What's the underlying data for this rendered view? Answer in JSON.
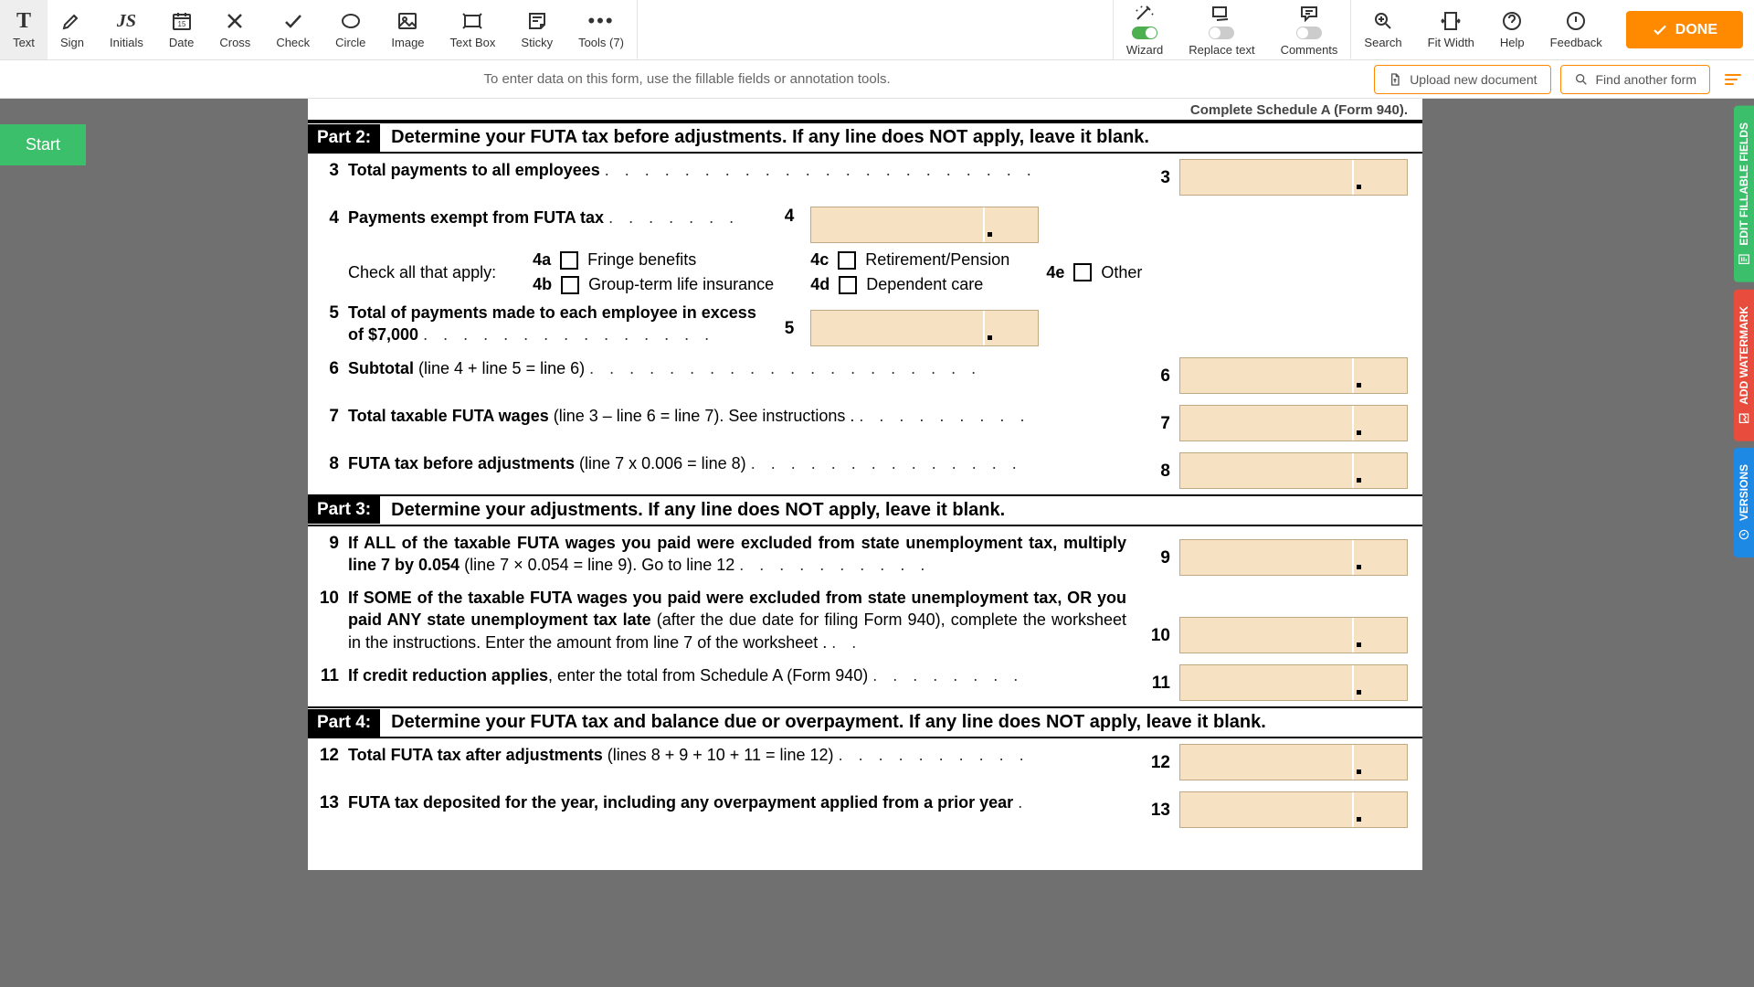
{
  "toolbar": {
    "text": "Text",
    "sign": "Sign",
    "initials": "Initials",
    "date": "Date",
    "cross": "Cross",
    "check": "Check",
    "circle": "Circle",
    "image": "Image",
    "textbox": "Text Box",
    "sticky": "Sticky",
    "tools": "Tools (7)",
    "wizard": "Wizard",
    "replace": "Replace text",
    "comments": "Comments",
    "search": "Search",
    "fitwidth": "Fit Width",
    "help": "Help",
    "feedback": "Feedback",
    "done": "DONE"
  },
  "subbar": {
    "hint": "To enter data on this form, use the fillable fields or annotation tools.",
    "upload": "Upload new document",
    "find": "Find another form"
  },
  "start": "Start",
  "side": {
    "edit": "EDIT FILLABLE FIELDS",
    "watermark": "ADD WATERMARK",
    "versions": "VERSIONS"
  },
  "doc": {
    "peek": "Complete Schedule A (Form 940).",
    "part2": {
      "tag": "Part 2:",
      "title": "Determine your FUTA tax before adjustments. If any line does NOT apply, leave it blank."
    },
    "l3": {
      "no": "3",
      "text": "Total payments to all employees",
      "rno": "3"
    },
    "l4": {
      "no": "4",
      "text": "Payments exempt from FUTA tax",
      "mno": "4"
    },
    "l4chk": {
      "intro": "Check all that apply:",
      "a_lbl": "4a",
      "a_txt": "Fringe benefits",
      "b_lbl": "4b",
      "b_txt": "Group-term life insurance",
      "c_lbl": "4c",
      "c_txt": "Retirement/Pension",
      "d_lbl": "4d",
      "d_txt": "Dependent care",
      "e_lbl": "4e",
      "e_txt": "Other"
    },
    "l5": {
      "no": "5",
      "text": "Total of payments made to each employee in excess of $7,000",
      "mno": "5"
    },
    "l6": {
      "no": "6",
      "bold": "Subtotal",
      "note": " (line 4 + line 5 = line 6)",
      "rno": "6"
    },
    "l7": {
      "no": "7",
      "bold": "Total taxable FUTA wages",
      "note": " (line 3 – line 6 = line 7). See instructions .",
      "rno": "7"
    },
    "l8": {
      "no": "8",
      "bold": "FUTA tax before adjustments",
      "note": " (line 7 x 0.006 = line 8)",
      "rno": "8"
    },
    "part3": {
      "tag": "Part 3:",
      "title": "Determine your adjustments. If any line does NOT apply, leave it blank."
    },
    "l9": {
      "no": "9",
      "text": "If ALL of the taxable FUTA wages you paid were excluded from state unemployment tax, multiply line 7 by 0.054",
      "note": "  (line 7 × 0.054 = line 9). Go to line 12",
      "rno": "9"
    },
    "l10": {
      "no": "10",
      "text": "If SOME of the taxable FUTA wages you paid were excluded from state unemployment tax, OR you paid ANY state unemployment tax late",
      "note": " (after the due date for filing Form 940), complete the worksheet in the instructions. Enter the amount from line 7 of the worksheet .",
      "rno": "10"
    },
    "l11": {
      "no": "11",
      "bold": "If credit reduction applies",
      "note": ", enter the total from Schedule A (Form 940)",
      "rno": "11"
    },
    "part4": {
      "tag": "Part 4:",
      "title": "Determine your FUTA tax and balance due or overpayment. If any line does NOT apply, leave it blank."
    },
    "l12": {
      "no": "12",
      "bold": "Total FUTA tax after adjustments",
      "note": " (lines 8 + 9 + 10 + 11 = line 12)",
      "rno": "12"
    },
    "l13": {
      "no": "13",
      "text": "FUTA tax deposited for the year, including any overpayment applied from a prior year",
      "rno": "13"
    }
  }
}
